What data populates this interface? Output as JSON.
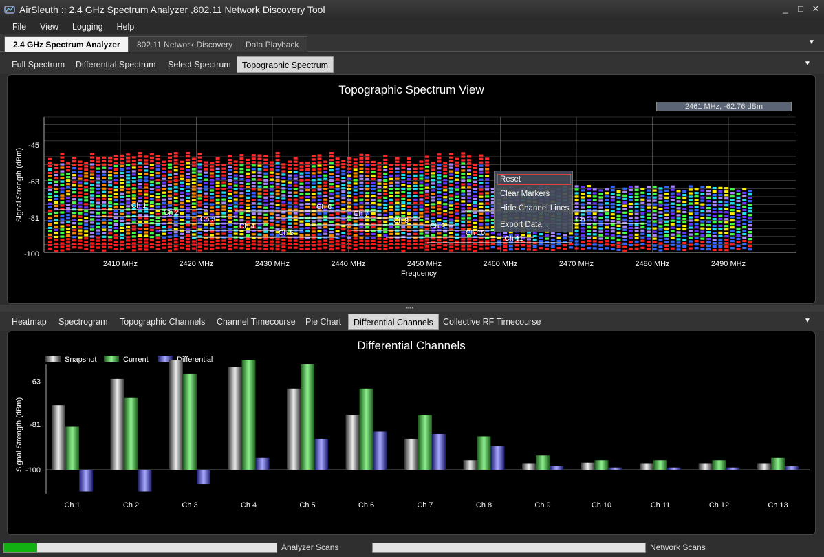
{
  "window": {
    "title": "AirSleuth :: 2.4 GHz Spectrum Analyzer ,802.11 Network Discovery Tool",
    "minimize": "_",
    "maximize": "□",
    "close": "✕"
  },
  "menu": [
    "File",
    "View",
    "Logging",
    "Help"
  ],
  "top_tabs": [
    "2.4 GHz Spectrum Analyzer",
    "802.11 Network Discovery",
    "Data Playback"
  ],
  "spectrum_tabs": [
    "Full Spectrum",
    "Differential Spectrum",
    "Select Spectrum",
    "Topographic Spectrum"
  ],
  "topo": {
    "title": "Topographic Spectrum View",
    "readout": "2461 MHz,   -62.76 dBm",
    "ylabel": "Signal Strength (dBm)",
    "xlabel": "Frequency",
    "yticks": [
      "-45",
      "-63",
      "-81",
      "-100"
    ],
    "xticks": [
      "2410 MHz",
      "2420 MHz",
      "2430 MHz",
      "2440 MHz",
      "2450 MHz",
      "2460 MHz",
      "2470 MHz",
      "2480 MHz",
      "2490 MHz"
    ],
    "channels": [
      "Ch 1",
      "Ch 2",
      "Ch 3",
      "Ch 4",
      "Ch 5",
      "Ch 6",
      "Ch 7",
      "Ch 8",
      "Ch 9",
      "Ch 10",
      "Ch 11",
      "Ch 12",
      "Ch 13"
    ]
  },
  "context_menu": [
    "Reset",
    "Clear Markers",
    "Hide Channel Lines",
    "Export Data..."
  ],
  "bottom_tabs": [
    "Heatmap",
    "Spectrogram",
    "Topographic Channels",
    "Channel Timecourse",
    "Pie Chart",
    "Differential Channels",
    "Collective RF Timecourse"
  ],
  "chart_data": {
    "type": "bar",
    "title": "Differential Channels",
    "ylabel": "Signal Strength (dBm)",
    "xlabel": "",
    "categories": [
      "Ch 1",
      "Ch 2",
      "Ch 3",
      "Ch 4",
      "Ch 5",
      "Ch 6",
      "Ch 7",
      "Ch 8",
      "Ch 9",
      "Ch 10",
      "Ch 11",
      "Ch 12",
      "Ch 13"
    ],
    "yticks": [
      "-63",
      "-81",
      "-100"
    ],
    "ylim": [
      -110,
      -56
    ],
    "legend_position": "top-left",
    "series": [
      {
        "name": "Snapshot",
        "color": "#c8c8c8",
        "values": [
          -73,
          -62,
          -54,
          -57,
          -66,
          -77,
          -87,
          -96,
          -97.5,
          -97,
          -97.5,
          -97.5,
          -97.5
        ]
      },
      {
        "name": "Current",
        "color": "#5ac85a",
        "values": [
          -82,
          -70,
          -60,
          -54,
          -56,
          -66,
          -77,
          -86,
          -94,
          -96,
          -96,
          -96,
          -95
        ]
      },
      {
        "name": "Differential",
        "color": "#6a6ae0",
        "values": [
          -109,
          -109,
          -106,
          -95,
          -87,
          -84,
          -85,
          -90,
          -98.5,
          -99,
          -99,
          -99,
          -98.5
        ]
      }
    ]
  },
  "status": {
    "analyzer_label": "Analyzer Scans",
    "network_label": "Network Scans",
    "analyzer_progress": 0.12,
    "network_progress": 0.0
  },
  "colors": {
    "accent_green": "#12b012",
    "context_highlight": "#e04040"
  }
}
